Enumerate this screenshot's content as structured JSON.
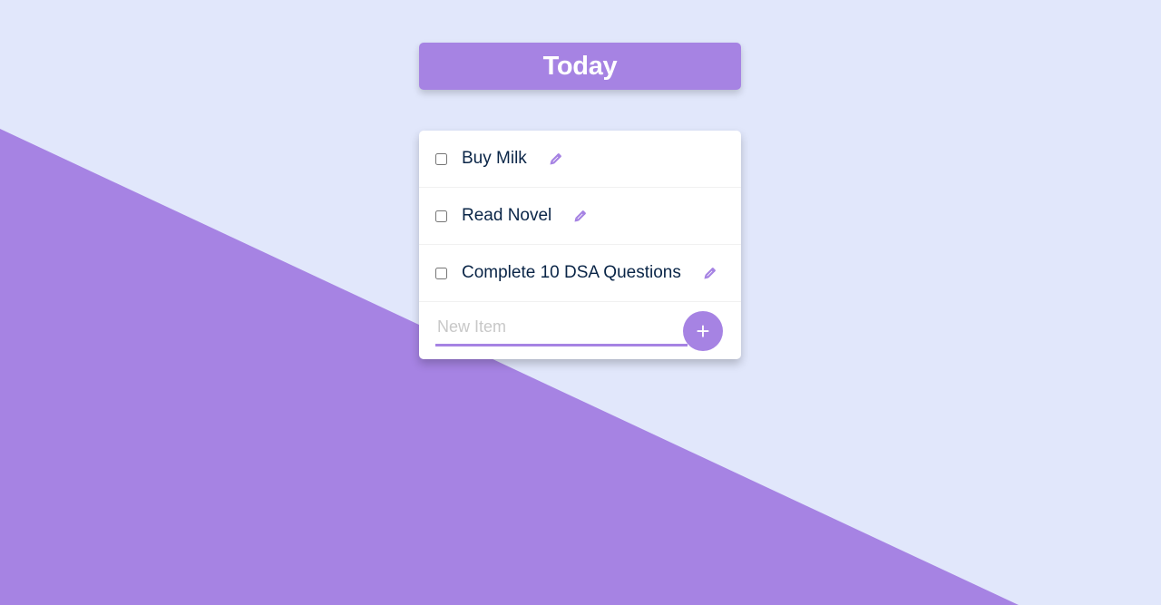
{
  "colors": {
    "background": "#E1E7FB",
    "accent": "#A683E3",
    "text": "#0A2547",
    "placeholder": "#C8C8C8",
    "card": "#FFFFFF"
  },
  "header": {
    "title": "Today"
  },
  "items": [
    {
      "label": "Buy Milk",
      "checked": false,
      "icon": "pencil-icon"
    },
    {
      "label": "Read Novel",
      "checked": false,
      "icon": "pencil-icon"
    },
    {
      "label": "Complete 10 DSA Questions",
      "checked": false,
      "icon": "pencil-icon"
    }
  ],
  "new_item": {
    "placeholder": "New Item",
    "value": ""
  },
  "add_button": {
    "label": "+"
  }
}
